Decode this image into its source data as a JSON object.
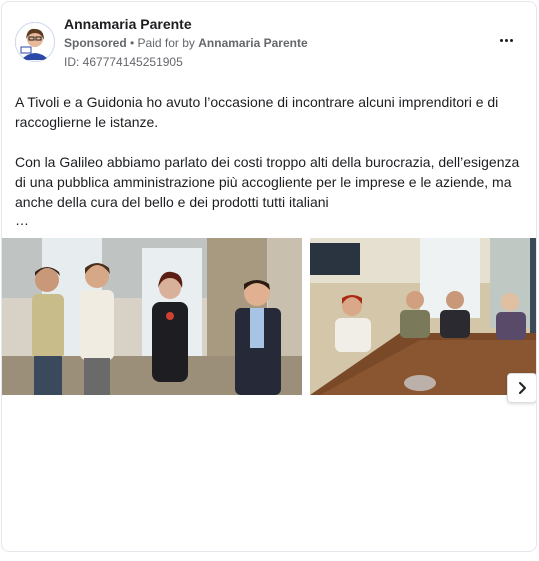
{
  "post": {
    "author": "Annamaria Parente",
    "sponsored_label": "Sponsored",
    "separator": " • Paid for by ",
    "paid_by": "Annamaria Parente",
    "ad_id": "ID: 467774145251905",
    "paragraphs": [
      "A Tivoli e a Guidonia ho avuto l’occasione di incontrare alcuni imprenditori e di raccoglierne le istanze.",
      "Con la Galileo abbiamo parlato dei costi troppo alti della burocrazia, dell’esigenza di una pubblica amministrazione più accogliente per le imprese e le aziende, ma anche della cura del bello e dei prodotti tutti italiani"
    ],
    "ellipsis": "…"
  },
  "icons": {
    "more": "more-options-icon",
    "next": "chevron-right-icon",
    "avatar": "profile-avatar"
  }
}
